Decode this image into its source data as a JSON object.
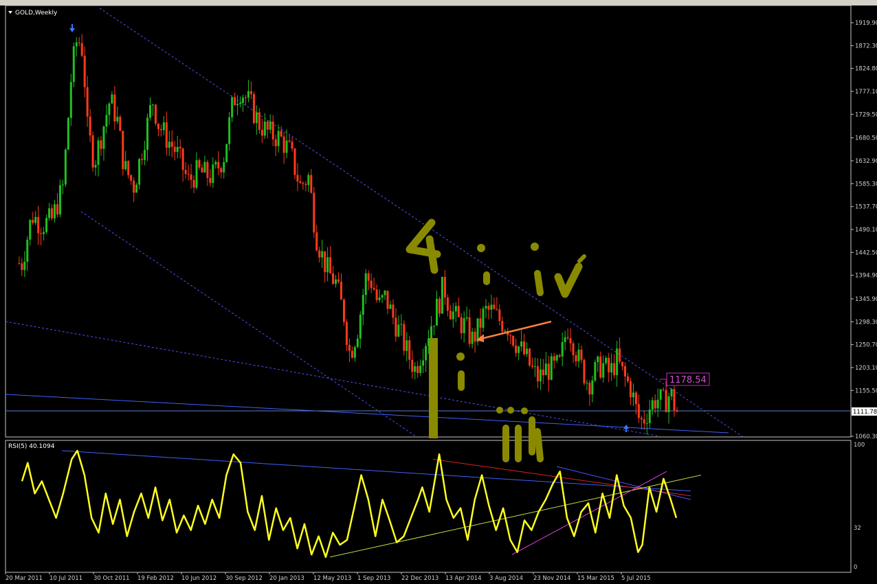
{
  "chart_data": {
    "type": "candlestick",
    "title": "GOLD,Weekly",
    "price_axis": {
      "ticks": [
        "1919.90",
        "1872.30",
        "1824.80",
        "1777.10",
        "1729.50",
        "1680.50",
        "1632.90",
        "1585.30",
        "1537.70",
        "1490.10",
        "1442.50",
        "1394.90",
        "1345.90",
        "1298.30",
        "1250.70",
        "1203.10",
        "1155.50",
        "1060.30"
      ],
      "ylim": [
        1060.3,
        1919.9
      ],
      "current_price": "1111.78",
      "marker_price": "1178.54"
    },
    "time_axis": {
      "labels": [
        "20 Mar 2011",
        "10 Jul 2011",
        "30 Oct 2011",
        "19 Feb 2012",
        "10 Jun 2012",
        "30 Sep 2012",
        "20 Jan 2013",
        "12 May 2013",
        "1 Sep 2013",
        "22 Dec 2013",
        "13 Apr 2014",
        "3 Aug 2014",
        "23 Nov 2014",
        "15 Mar 2015",
        "5 Jul 2015"
      ]
    },
    "close_path": [
      [
        2011.21,
        1420
      ],
      [
        2011.28,
        1520
      ],
      [
        2011.35,
        1500
      ],
      [
        2011.42,
        1510
      ],
      [
        2011.5,
        1580
      ],
      [
        2011.56,
        1820
      ],
      [
        2011.6,
        1890
      ],
      [
        2011.64,
        1860
      ],
      [
        2011.67,
        1700
      ],
      [
        2011.72,
        1630
      ],
      [
        2011.78,
        1700
      ],
      [
        2011.83,
        1760
      ],
      [
        2011.88,
        1720
      ],
      [
        2011.93,
        1620
      ],
      [
        2012.0,
        1580
      ],
      [
        2012.08,
        1690
      ],
      [
        2012.13,
        1760
      ],
      [
        2012.17,
        1710
      ],
      [
        2012.23,
        1680
      ],
      [
        2012.3,
        1650
      ],
      [
        2012.38,
        1590
      ],
      [
        2012.45,
        1610
      ],
      [
        2012.55,
        1600
      ],
      [
        2012.63,
        1640
      ],
      [
        2012.7,
        1760
      ],
      [
        2012.75,
        1780
      ],
      [
        2012.82,
        1750
      ],
      [
        2012.88,
        1710
      ],
      [
        2012.95,
        1690
      ],
      [
        2013.03,
        1680
      ],
      [
        2013.1,
        1650
      ],
      [
        2013.17,
        1580
      ],
      [
        2013.23,
        1600
      ],
      [
        2013.28,
        1480
      ],
      [
        2013.33,
        1430
      ],
      [
        2013.37,
        1400
      ],
      [
        2013.42,
        1380
      ],
      [
        2013.48,
        1310
      ],
      [
        2013.52,
        1230
      ],
      [
        2013.58,
        1290
      ],
      [
        2013.63,
        1390
      ],
      [
        2013.68,
        1380
      ],
      [
        2013.72,
        1330
      ],
      [
        2013.77,
        1350
      ],
      [
        2013.82,
        1310
      ],
      [
        2013.88,
        1270
      ],
      [
        2013.93,
        1230
      ],
      [
        2013.98,
        1200
      ],
      [
        2014.03,
        1240
      ],
      [
        2014.1,
        1300
      ],
      [
        2014.15,
        1340
      ],
      [
        2014.18,
        1375
      ],
      [
        2014.22,
        1330
      ],
      [
        2014.28,
        1300
      ],
      [
        2014.33,
        1290
      ],
      [
        2014.38,
        1260
      ],
      [
        2014.42,
        1280
      ],
      [
        2014.47,
        1320
      ],
      [
        2014.52,
        1320
      ],
      [
        2014.58,
        1300
      ],
      [
        2014.63,
        1290
      ],
      [
        2014.7,
        1250
      ],
      [
        2014.75,
        1230
      ],
      [
        2014.8,
        1200
      ],
      [
        2014.85,
        1180
      ],
      [
        2014.9,
        1200
      ],
      [
        2014.95,
        1200
      ],
      [
        2015.0,
        1210
      ],
      [
        2015.05,
        1290
      ],
      [
        2015.08,
        1270
      ],
      [
        2015.13,
        1220
      ],
      [
        2015.2,
        1170
      ],
      [
        2015.25,
        1195
      ],
      [
        2015.3,
        1210
      ],
      [
        2015.35,
        1190
      ],
      [
        2015.4,
        1220
      ],
      [
        2015.45,
        1185
      ],
      [
        2015.5,
        1160
      ],
      [
        2015.55,
        1100
      ],
      [
        2015.58,
        1090
      ],
      [
        2015.63,
        1120
      ],
      [
        2015.68,
        1140
      ],
      [
        2015.73,
        1130
      ],
      [
        2015.78,
        1150
      ],
      [
        2015.82,
        1112
      ]
    ],
    "rsi": {
      "label": "RSI(5) 40.1094",
      "levels": [
        "100",
        "32",
        "0"
      ],
      "path": [
        [
          2011.21,
          70
        ],
        [
          2011.25,
          85
        ],
        [
          2011.3,
          60
        ],
        [
          2011.35,
          70
        ],
        [
          2011.4,
          55
        ],
        [
          2011.45,
          40
        ],
        [
          2011.5,
          60
        ],
        [
          2011.56,
          88
        ],
        [
          2011.6,
          95
        ],
        [
          2011.65,
          75
        ],
        [
          2011.7,
          40
        ],
        [
          2011.75,
          28
        ],
        [
          2011.8,
          60
        ],
        [
          2011.85,
          35
        ],
        [
          2011.9,
          55
        ],
        [
          2011.95,
          25
        ],
        [
          2012.0,
          45
        ],
        [
          2012.05,
          60
        ],
        [
          2012.1,
          40
        ],
        [
          2012.15,
          65
        ],
        [
          2012.2,
          38
        ],
        [
          2012.25,
          55
        ],
        [
          2012.3,
          28
        ],
        [
          2012.35,
          42
        ],
        [
          2012.4,
          30
        ],
        [
          2012.45,
          50
        ],
        [
          2012.5,
          35
        ],
        [
          2012.55,
          55
        ],
        [
          2012.6,
          40
        ],
        [
          2012.65,
          75
        ],
        [
          2012.7,
          92
        ],
        [
          2012.75,
          85
        ],
        [
          2012.8,
          45
        ],
        [
          2012.85,
          30
        ],
        [
          2012.9,
          58
        ],
        [
          2012.95,
          22
        ],
        [
          2013.0,
          48
        ],
        [
          2013.05,
          30
        ],
        [
          2013.1,
          40
        ],
        [
          2013.15,
          15
        ],
        [
          2013.2,
          35
        ],
        [
          2013.25,
          10
        ],
        [
          2013.3,
          25
        ],
        [
          2013.35,
          8
        ],
        [
          2013.4,
          28
        ],
        [
          2013.45,
          18
        ],
        [
          2013.5,
          22
        ],
        [
          2013.55,
          48
        ],
        [
          2013.6,
          75
        ],
        [
          2013.65,
          55
        ],
        [
          2013.7,
          25
        ],
        [
          2013.75,
          55
        ],
        [
          2013.8,
          38
        ],
        [
          2013.85,
          20
        ],
        [
          2013.9,
          25
        ],
        [
          2013.95,
          40
        ],
        [
          2014.0,
          55
        ],
        [
          2014.03,
          65
        ],
        [
          2014.08,
          45
        ],
        [
          2014.15,
          92
        ],
        [
          2014.2,
          55
        ],
        [
          2014.25,
          40
        ],
        [
          2014.3,
          48
        ],
        [
          2014.35,
          22
        ],
        [
          2014.4,
          55
        ],
        [
          2014.45,
          75
        ],
        [
          2014.5,
          50
        ],
        [
          2014.55,
          30
        ],
        [
          2014.6,
          48
        ],
        [
          2014.65,
          22
        ],
        [
          2014.7,
          12
        ],
        [
          2014.75,
          38
        ],
        [
          2014.8,
          30
        ],
        [
          2014.85,
          45
        ],
        [
          2014.9,
          55
        ],
        [
          2014.95,
          68
        ],
        [
          2015.0,
          78
        ],
        [
          2015.05,
          40
        ],
        [
          2015.1,
          25
        ],
        [
          2015.15,
          45
        ],
        [
          2015.2,
          52
        ],
        [
          2015.25,
          28
        ],
        [
          2015.3,
          60
        ],
        [
          2015.35,
          40
        ],
        [
          2015.4,
          75
        ],
        [
          2015.45,
          50
        ],
        [
          2015.5,
          40
        ],
        [
          2015.55,
          12
        ],
        [
          2015.58,
          18
        ],
        [
          2015.63,
          65
        ],
        [
          2015.68,
          45
        ],
        [
          2015.73,
          72
        ],
        [
          2015.78,
          55
        ],
        [
          2015.82,
          40
        ]
      ]
    }
  }
}
